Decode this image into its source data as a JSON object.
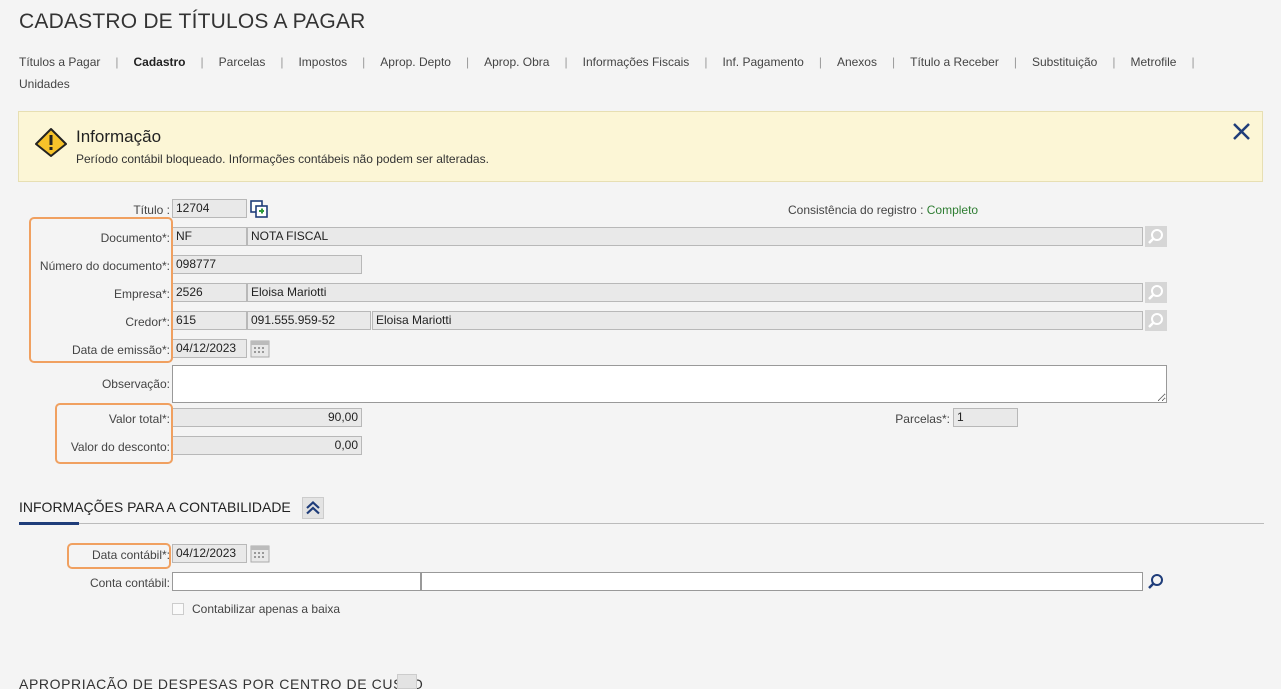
{
  "page": {
    "title": "CADASTRO DE TÍTULOS A PAGAR"
  },
  "tabs": [
    {
      "label": "Títulos a Pagar",
      "active": false
    },
    {
      "label": "Cadastro",
      "active": true
    },
    {
      "label": "Parcelas",
      "active": false
    },
    {
      "label": "Impostos",
      "active": false
    },
    {
      "label": "Aprop. Depto",
      "active": false
    },
    {
      "label": "Aprop. Obra",
      "active": false
    },
    {
      "label": "Informações Fiscais",
      "active": false
    },
    {
      "label": "Inf. Pagamento",
      "active": false
    },
    {
      "label": "Anexos",
      "active": false
    },
    {
      "label": "Título a Receber",
      "active": false
    },
    {
      "label": "Substituição",
      "active": false
    },
    {
      "label": "Metrofile",
      "active": false
    },
    {
      "label": "Unidades",
      "active": false
    }
  ],
  "alert": {
    "title": "Informação",
    "message": "Período contábil bloqueado. Informações contábeis não podem ser alteradas.",
    "icon": "warning-icon",
    "close_icon": "close-icon"
  },
  "form": {
    "titulo": {
      "label": "Título :",
      "value": "12704"
    },
    "consistencia": {
      "label": "Consistência do registro :",
      "value": "Completo"
    },
    "documento": {
      "label": "Documento*:",
      "code": "NF",
      "desc": "NOTA FISCAL"
    },
    "numero_documento": {
      "label": "Número do documento*:",
      "value": "098777"
    },
    "empresa": {
      "label": "Empresa*:",
      "code": "2526",
      "desc": "Eloisa Mariotti"
    },
    "credor": {
      "label": "Credor*:",
      "code": "615",
      "cpf": "091.555.959-52",
      "desc": "Eloisa Mariotti"
    },
    "data_emissao": {
      "label": "Data de emissão*:",
      "value": "04/12/2023"
    },
    "observacao": {
      "label": "Observação:",
      "value": ""
    },
    "valor_total": {
      "label": "Valor total*:",
      "value": "90,00"
    },
    "parcelas": {
      "label": "Parcelas*:",
      "value": "1"
    },
    "valor_desconto": {
      "label": "Valor do desconto:",
      "value": "0,00"
    }
  },
  "contabilidade": {
    "title": "INFORMAÇÕES PARA A CONTABILIDADE",
    "data_contabil": {
      "label": "Data contábil*:",
      "value": "04/12/2023"
    },
    "conta_contabil": {
      "label": "Conta contábil:",
      "code": "",
      "desc": ""
    },
    "contabilizar": {
      "label": "Contabilizar apenas a baixa",
      "checked": false
    }
  },
  "next_section": {
    "title": "APROPRIAÇÃO DE DESPESAS POR CENTRO DE CUSTO"
  },
  "colors": {
    "highlight": "#f0a060",
    "status_ok": "#2e7d32",
    "alert_bg": "#fcf6d6",
    "accent": "#1f3d7a"
  }
}
